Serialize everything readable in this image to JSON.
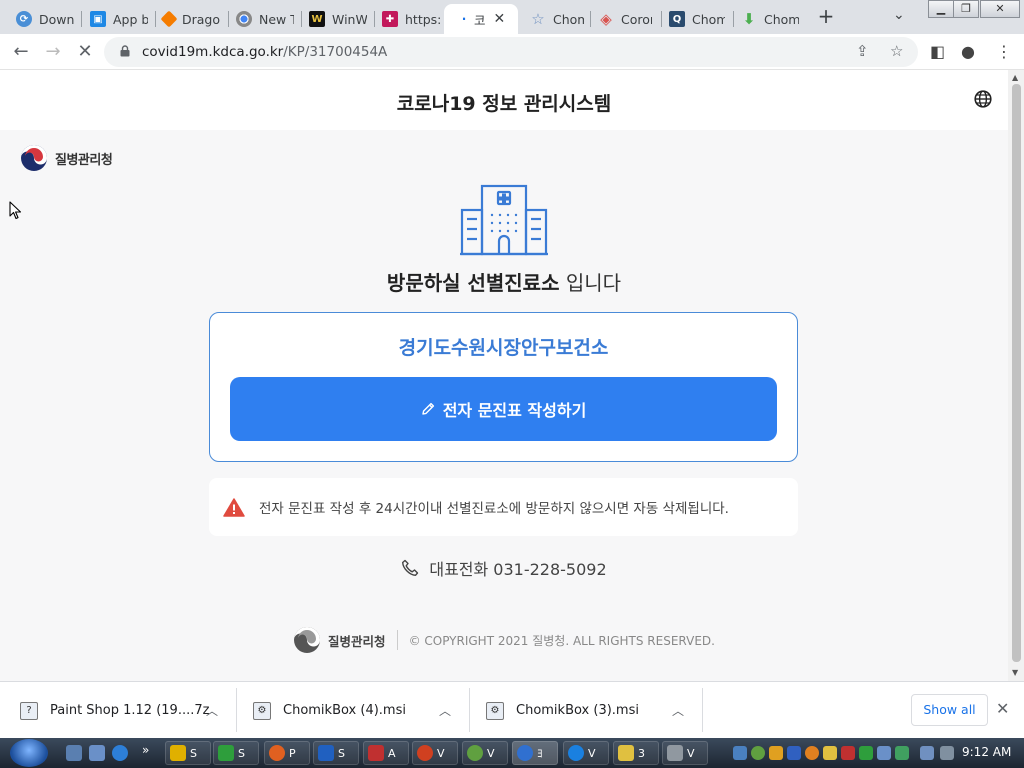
{
  "browser": {
    "tabs": [
      {
        "label": "Downl",
        "color": "#4a8fd6",
        "icon": "download-favicon"
      },
      {
        "label": "App b",
        "color": "#1e88e5",
        "icon": "app-favicon"
      },
      {
        "label": "Drago",
        "color": "#f57c00",
        "icon": "diamond-favicon"
      },
      {
        "label": "New T",
        "color": "#555555",
        "icon": "chrome-favicon"
      },
      {
        "label": "WinW",
        "color": "#111111",
        "icon": "w-favicon"
      },
      {
        "label": "https:",
        "color": "#c2185b",
        "icon": "cross-favicon"
      },
      {
        "label": "코",
        "color": "#ffffff",
        "icon": "loading-favicon",
        "active": true
      },
      {
        "label": "Chom",
        "color": "#6c8ebf",
        "icon": "star-favicon"
      },
      {
        "label": "Coron",
        "color": "#d9534f",
        "icon": "diamond-favicon"
      },
      {
        "label": "Chom",
        "color": "#2a4b6e",
        "icon": "q-favicon"
      },
      {
        "label": "Chom",
        "color": "#4caf50",
        "icon": "download-arrow-favicon"
      }
    ],
    "url_host": "covid19m.kdca.go.kr",
    "url_path": "/KP/31700454A"
  },
  "site": {
    "title": "코로나19 정보 관리시스템",
    "org_logo_text": "질병관리청",
    "headline_bold": "방문하실 선별진료소",
    "headline_rest": " 입니다",
    "center_name": "경기도수원시장안구보건소",
    "cta_label": "전자 문진표 작성하기",
    "notice": "전자 문진표 작성 후 24시간이내 선별진료소에 방문하지 않으시면 자동 삭제됩니다.",
    "phone_label": "대표전화 031-228-5092",
    "footer_logo_text": "질병관리청",
    "copyright": "© COPYRIGHT 2021 질병청. ALL RIGHTS RESERVED.",
    "colors": {
      "primary": "#2f7ff0",
      "accent_text": "#3a7bd5",
      "warning": "#e04b3f"
    }
  },
  "downloads": {
    "items": [
      {
        "name": "Paint Shop 1.12 (19....7z"
      },
      {
        "name": "ChomikBox (4).msi"
      },
      {
        "name": "ChomikBox (3).msi"
      }
    ],
    "show_all": "Show all"
  },
  "taskbar": {
    "buttons": [
      {
        "label": "S",
        "color": "#e0b000"
      },
      {
        "label": "S",
        "color": "#2e9e3c"
      },
      {
        "label": "P",
        "color": "#e06020"
      },
      {
        "label": "S",
        "color": "#2060c0"
      },
      {
        "label": "A",
        "color": "#c03030"
      },
      {
        "label": "V",
        "color": "#d04020"
      },
      {
        "label": "V",
        "color": "#60a040"
      },
      {
        "label": "ﾖ",
        "color": "#3070d0"
      },
      {
        "label": "V",
        "color": "#1a80e0"
      },
      {
        "label": "3",
        "color": "#e0c040"
      },
      {
        "label": "V",
        "color": "#9098a0"
      }
    ],
    "clock": "9:12 AM"
  }
}
